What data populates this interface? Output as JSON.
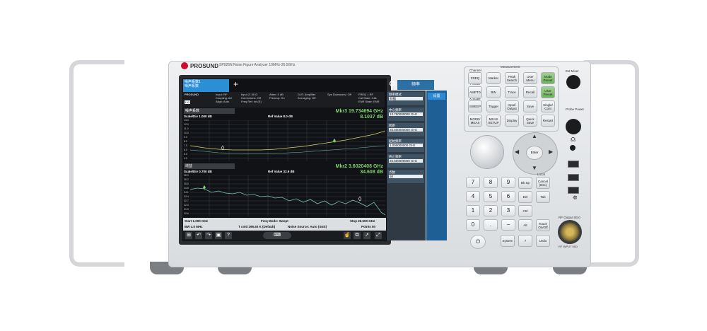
{
  "brand": {
    "name": "PROSUND",
    "model": "SP926N Noise Figure Analyzer 10MHz-26.5GHz"
  },
  "screen": {
    "tab1": {
      "line1": "噪声系数1",
      "line2": "噪声系数"
    },
    "plus": "+",
    "menu_tab": "频率",
    "status": {
      "brand": "PROSUND",
      "lxi": "LXI",
      "input": "Input: RF",
      "coupling": "Coupling: AC",
      "align": "Align: Auto",
      "input_z": "Input Z: 50 Ω",
      "corrections": "Corrections: Off",
      "freq_ref": "Freq Ref: Int (S)",
      "atten": "Atten: 0 dB",
      "preamp": "Preamp: On",
      "dut": "DUT: Amplifier",
      "averaging": "Averaging: Off",
      "sys_downconv": "Sys Downconv: Off",
      "freq_rf": "FREQ = RF",
      "cal_state": "Cal State: CAL",
      "enr_state": "ENR State: ENR"
    },
    "trace1": {
      "title": "噪声系数",
      "scale": "Scale/Div 1.000 dB",
      "ref": "Ref Value 8.0 dB",
      "marker_line1": "Mkr3  19.734694 GHz",
      "marker_line2": "8.1037 dB",
      "y_ticks": [
        "13.0",
        "12.0",
        "11.0",
        "10.0",
        "9.0",
        "8.0",
        "7.0",
        "6.0",
        "5.0",
        "4.0"
      ]
    },
    "trace2": {
      "title": "增益",
      "scale": "Scale/Div 0.700 dB",
      "ref": "Ref Value 33.9 dB",
      "marker_line1": "Mkr2  3.6020408 GHz",
      "marker_line2": "34.608 dB",
      "y_ticks": [
        "36.9",
        "36.2",
        "35.5",
        "34.8",
        "34.1",
        "33.4",
        "32.7",
        "32.0",
        "31.3",
        "30.6"
      ]
    },
    "bottom": {
      "start": "Start 1.000 GHz",
      "bw": "BW 4.0 MHz",
      "mode": "Freq Mode: Swept",
      "tcold": "T cold 296.50 K (Default)",
      "noise_source": "Noise Source: Auto (SNS)",
      "stop": "Stop 26.500 GHz",
      "points": "Points 50"
    },
    "panel": {
      "items": [
        {
          "label": "频率模式",
          "value": "扫描"
        },
        {
          "label": "中心频率",
          "value": "13.750000000 GHz"
        },
        {
          "label": "跨距",
          "value": "25.500000000 GHz"
        },
        {
          "label": "起始频率",
          "value": "1.000000000 GHz"
        },
        {
          "label": "终止频率",
          "value": "26.500000000 GHz"
        },
        {
          "label": "点数",
          "value": "50"
        }
      ],
      "settings": "设置"
    }
  },
  "keypad": {
    "measurement_label": "Measurement",
    "channel_label": "Channel",
    "yscale_label": "Y Scale",
    "xscale_label": "X Scale",
    "keys": [
      "FREQ",
      "Marker",
      "Peak Search",
      "User Menu",
      "Mode Preset",
      "AMPTD",
      "BW",
      "Trace",
      "Recall",
      "User Preset",
      "SWEEP",
      "Trigger",
      "Input/ Output",
      "Save",
      "Single/ Cont",
      "MODE/ MEAS",
      "MEAS SETUP",
      "Display",
      "Quick Save",
      "Restart"
    ],
    "numbers": [
      "7",
      "8",
      "9",
      "4",
      "5",
      "6",
      "1",
      "2",
      "3",
      "0",
      "."
    ],
    "side_keys": [
      "Bk Sp",
      "Tab",
      "Del",
      "Ctrl",
      "Alt",
      "Touch On/Off",
      "System",
      "?",
      "Undo"
    ],
    "local_label": "Local",
    "local_key": "Cancel (Esc)",
    "enter": "Enter",
    "ext_mixer": "Ext Mixer",
    "probe_power": "Probe Power",
    "rf_output": "RF Output 80.0",
    "rf_input": "RF INPUT 50Ω"
  }
}
